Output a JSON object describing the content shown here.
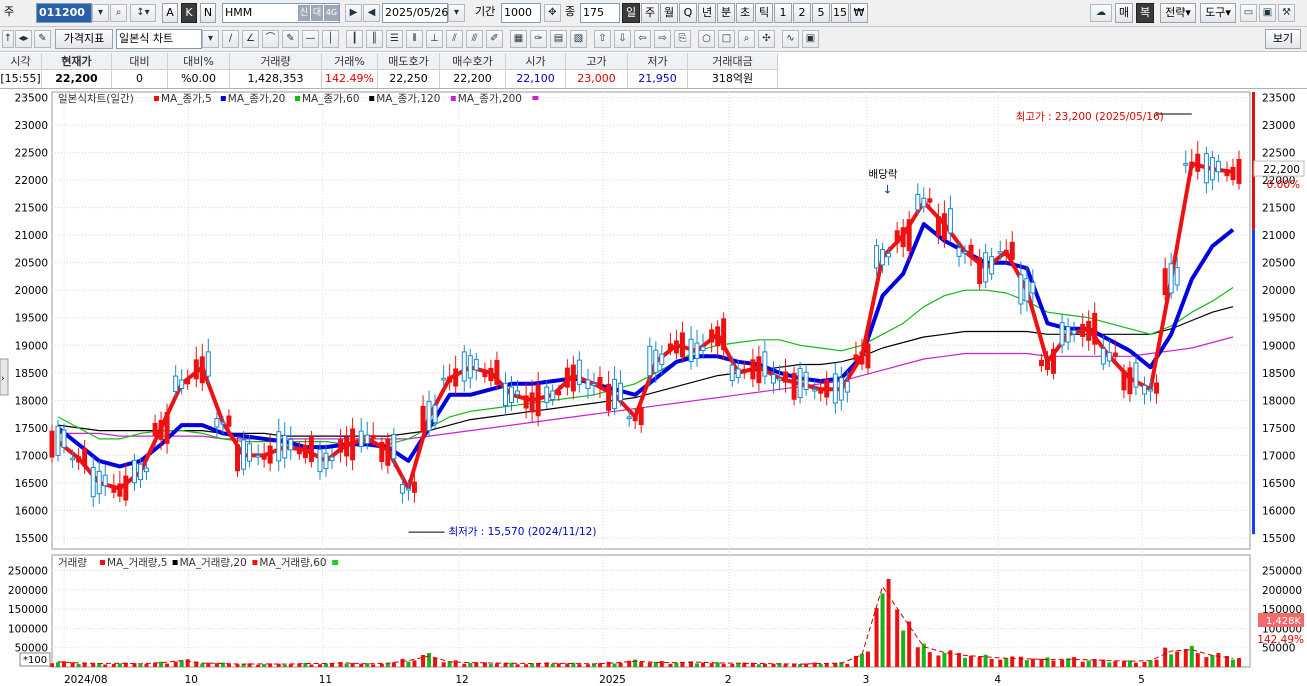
{
  "toolbar": {
    "type_label": "주",
    "code": "011200",
    "stock_name": "HMM",
    "date": "2025/05/26",
    "period_label": "기간",
    "period_value": "1000",
    "count_label": "종",
    "count_value": "175",
    "letter_buttons": [
      "A",
      "K",
      "N"
    ],
    "tag_buttons": [
      "신",
      "대",
      "4G"
    ],
    "period_buttons": [
      "일",
      "주",
      "월",
      "Q",
      "년",
      "분",
      "초",
      "틱",
      "1",
      "2",
      "5",
      "15",
      "₩"
    ],
    "right_buttons": [
      "매",
      "복",
      "전략",
      "도구"
    ],
    "price_indicator_label": "가격지표",
    "chart_type_label": "일본식 차트",
    "view_label": "보기"
  },
  "quote": {
    "headers": [
      "시각",
      "현재가",
      "대비",
      "대비%",
      "거래량",
      "거래%",
      "매도호가",
      "매수호가",
      "시가",
      "고가",
      "저가",
      "거래대금"
    ],
    "values": [
      "[15:55]",
      "22,200",
      "0",
      "%0.00",
      "1,428,353",
      "142.49%",
      "22,250",
      "22,200",
      "22,100",
      "23,000",
      "21,950",
      "318억원"
    ]
  },
  "legend": {
    "price_title": "일본식차트(일간)",
    "price_mas": [
      "MA_종가,5",
      "MA_종가,20",
      "MA_종가,60",
      "MA_종가,120",
      "MA_종가,200"
    ],
    "volume_title": "거래량",
    "volume_mas": [
      "MA_거래량,5",
      "MA_거래량,20",
      "MA_거래량,60"
    ]
  },
  "annotations": {
    "high": "최고가 : 23,200 (2025/05/16)",
    "low": "최저가 : 15,570 (2024/11/12)",
    "dividend": "배당락",
    "price_tag": "22,200",
    "pct_tag": "0.00%",
    "vol_tag": "1,428K",
    "vol_pct": "142.49%",
    "vol_scale": "*100"
  },
  "colors": {
    "ma5": "#ee1111",
    "ma20": "#0000e0",
    "ma60": "#11bb11",
    "ma120": "#000000",
    "ma200": "#cc22cc",
    "up": "#ee1111",
    "down": "#1ab31a",
    "dn_candle": "#1a88d0",
    "accent": "#2b5fa8"
  },
  "chart_data": [
    {
      "type": "candlestick",
      "x_tick_labels": [
        "2024/08",
        "10",
        "11",
        "12",
        "2025",
        "2",
        "3",
        "4",
        "5"
      ],
      "y_range": [
        15300,
        23600
      ],
      "y_ticks": [
        15500,
        16000,
        16500,
        17000,
        17500,
        18000,
        18500,
        19000,
        19500,
        20000,
        20500,
        21000,
        21500,
        22000,
        22500,
        23000,
        23500
      ],
      "high": {
        "value": 23200,
        "date": "2025/05/16"
      },
      "low": {
        "value": 15570,
        "date": "2024/11/12"
      },
      "last_close": 22200,
      "ma5": [
        17250,
        16950,
        16500,
        16400,
        16700,
        17500,
        18300,
        18600,
        17600,
        17000,
        17000,
        17150,
        17100,
        16900,
        17200,
        17300,
        17100,
        16400,
        17700,
        18400,
        18600,
        18500,
        18100,
        18000,
        18100,
        18450,
        18300,
        18100,
        17700,
        18700,
        19000,
        18900,
        19200,
        18500,
        18600,
        18400,
        18300,
        18200,
        18200,
        18800,
        20600,
        21000,
        21600,
        21200,
        20700,
        20400,
        20700,
        20000,
        18700,
        19200,
        19300,
        18800,
        18400,
        18200,
        20200,
        22300,
        22200,
        22150
      ],
      "ma20": [
        17500,
        17200,
        16900,
        16800,
        16900,
        17200,
        17550,
        17550,
        17400,
        17350,
        17300,
        17250,
        17150,
        17150,
        17200,
        17200,
        17150,
        16900,
        17500,
        18100,
        18100,
        18200,
        18300,
        18300,
        18350,
        18400,
        18300,
        18200,
        18100,
        18400,
        18700,
        18800,
        18800,
        18700,
        18650,
        18500,
        18400,
        18350,
        18400,
        18800,
        19900,
        20300,
        21200,
        20900,
        20700,
        20500,
        20500,
        20400,
        19400,
        19300,
        19300,
        19100,
        18900,
        18600,
        19200,
        20200,
        20800,
        21100
      ],
      "ma60": [
        17700,
        17500,
        17300,
        17300,
        17400,
        17450,
        17450,
        17400,
        17300,
        17250,
        17250,
        17250,
        17250,
        17250,
        17200,
        17200,
        17200,
        17300,
        17500,
        17700,
        17800,
        17850,
        17900,
        17950,
        18000,
        18050,
        18100,
        18200,
        18300,
        18500,
        18700,
        18900,
        19000,
        19050,
        19100,
        19100,
        19000,
        18950,
        18900,
        19000,
        19200,
        19400,
        19700,
        19900,
        20000,
        20000,
        19950,
        19800,
        19600,
        19550,
        19500,
        19400,
        19300,
        19200,
        19350,
        19600,
        19800,
        20050
      ],
      "ma120": [
        17550,
        17500,
        17450,
        17450,
        17450,
        17450,
        17450,
        17450,
        17400,
        17400,
        17400,
        17350,
        17350,
        17350,
        17350,
        17350,
        17350,
        17400,
        17450,
        17550,
        17650,
        17700,
        17750,
        17800,
        17850,
        17900,
        17950,
        18000,
        18050,
        18150,
        18250,
        18350,
        18450,
        18500,
        18550,
        18600,
        18650,
        18650,
        18700,
        18800,
        18950,
        19050,
        19150,
        19200,
        19250,
        19250,
        19250,
        19250,
        19200,
        19200,
        19200,
        19200,
        19200,
        19200,
        19300,
        19450,
        19600,
        19700
      ],
      "ma200": [
        17400,
        17400,
        17400,
        17350,
        17350,
        17350,
        17350,
        17350,
        17300,
        17300,
        17300,
        17300,
        17300,
        17300,
        17300,
        17300,
        17300,
        17300,
        17350,
        17400,
        17450,
        17500,
        17550,
        17600,
        17650,
        17700,
        17750,
        17800,
        17850,
        17900,
        17950,
        18000,
        18050,
        18100,
        18150,
        18200,
        18250,
        18300,
        18350,
        18450,
        18550,
        18650,
        18750,
        18800,
        18850,
        18850,
        18850,
        18850,
        18800,
        18800,
        18800,
        18800,
        18800,
        18850,
        18900,
        18950,
        19050,
        19150
      ]
    },
    {
      "type": "bar",
      "title": "거래량",
      "y_range": [
        0,
        290000
      ],
      "y_ticks": [
        50000,
        100000,
        150000,
        200000,
        250000
      ],
      "values": [
        18000,
        14000,
        12000,
        13000,
        11000,
        15000,
        22000,
        14000,
        12000,
        10000,
        11000,
        10000,
        12000,
        12000,
        14000,
        11000,
        13000,
        22000,
        38000,
        18000,
        15000,
        14000,
        13000,
        12000,
        13000,
        12000,
        11000,
        14000,
        20000,
        16000,
        15000,
        17000,
        14000,
        13000,
        12000,
        11000,
        10000,
        12000,
        13000,
        42000,
        278000,
        172000,
        70000,
        50000,
        40000,
        35000,
        30000,
        28000,
        26000,
        27000,
        25000,
        22000,
        20000,
        22000,
        55000,
        60000,
        40000,
        30000
      ],
      "last_volume": "1,428K"
    }
  ]
}
